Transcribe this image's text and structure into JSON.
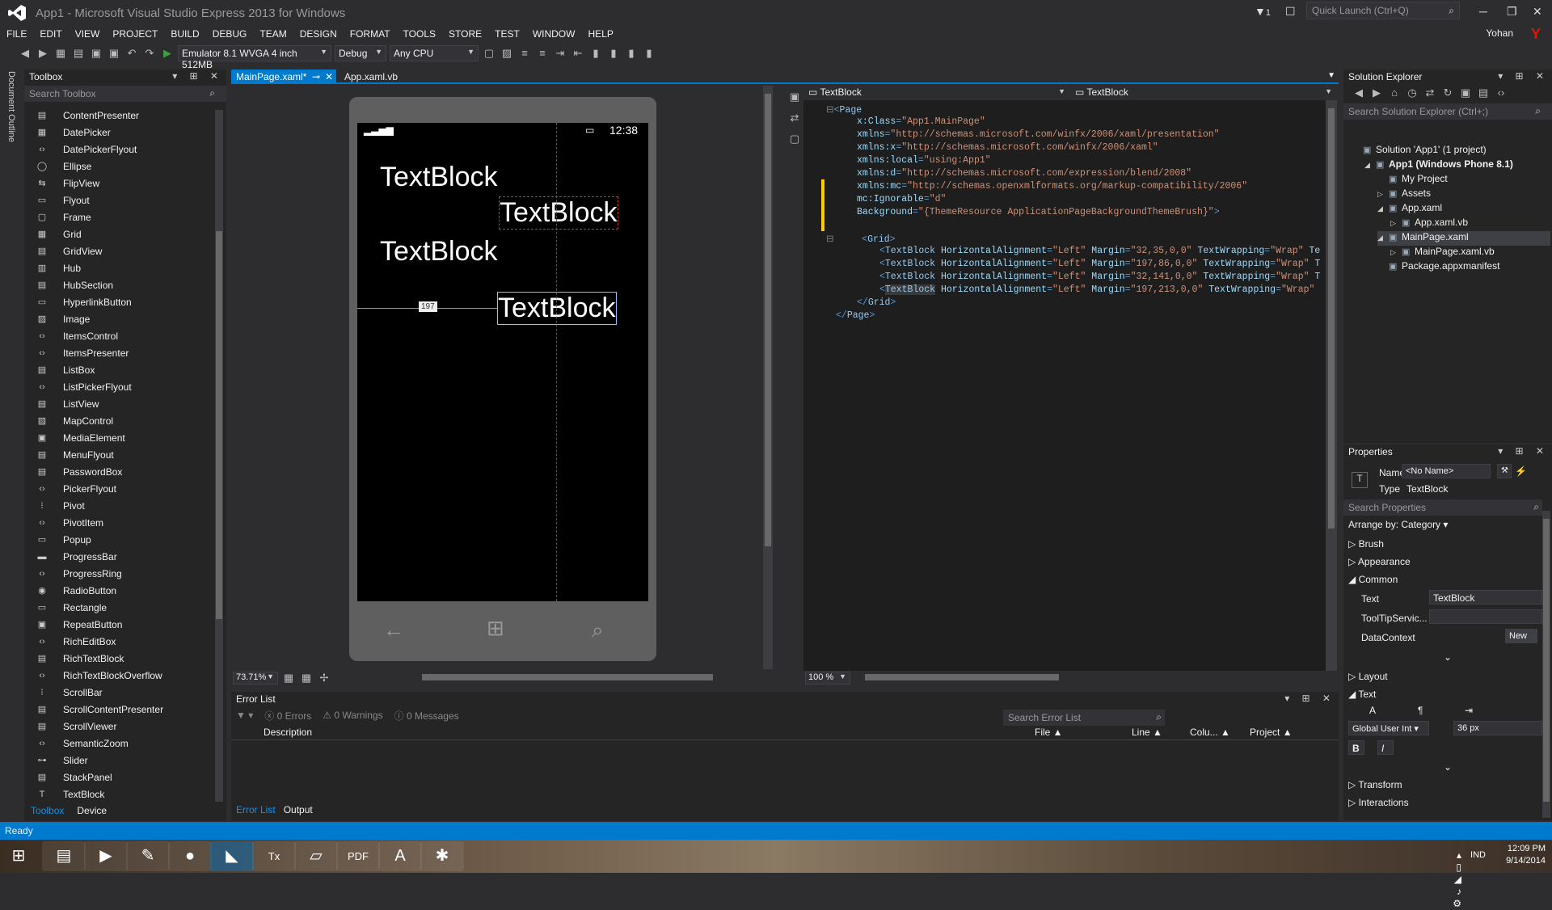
{
  "window": {
    "title": "App1 - Microsoft Visual Studio Express 2013 for Windows",
    "notification_count": "1",
    "quick_launch_placeholder": "Quick Launch (Ctrl+Q)",
    "user": "Yohan",
    "user_initial": "Y"
  },
  "menu": [
    "FILE",
    "EDIT",
    "VIEW",
    "PROJECT",
    "BUILD",
    "DEBUG",
    "TEAM",
    "DESIGN",
    "FORMAT",
    "TOOLS",
    "STORE",
    "TEST",
    "WINDOW",
    "HELP"
  ],
  "toolbar": {
    "target": "Emulator 8.1 WVGA 4 inch 512MB",
    "config": "Debug",
    "platform": "Any CPU"
  },
  "left_strip": "Document Outline",
  "toolbox": {
    "title": "Toolbox",
    "search_placeholder": "Search Toolbox",
    "items": [
      {
        "icon": "▤",
        "label": "ContentPresenter"
      },
      {
        "icon": "▦",
        "label": "DatePicker"
      },
      {
        "icon": "‹›",
        "label": "DatePickerFlyout"
      },
      {
        "icon": "◯",
        "label": "Ellipse"
      },
      {
        "icon": "⇆",
        "label": "FlipView"
      },
      {
        "icon": "▭",
        "label": "Flyout"
      },
      {
        "icon": "▢",
        "label": "Frame"
      },
      {
        "icon": "▦",
        "label": "Grid"
      },
      {
        "icon": "▤",
        "label": "GridView"
      },
      {
        "icon": "▥",
        "label": "Hub"
      },
      {
        "icon": "▤",
        "label": "HubSection"
      },
      {
        "icon": "▭",
        "label": "HyperlinkButton"
      },
      {
        "icon": "▨",
        "label": "Image"
      },
      {
        "icon": "‹›",
        "label": "ItemsControl"
      },
      {
        "icon": "‹›",
        "label": "ItemsPresenter"
      },
      {
        "icon": "▤",
        "label": "ListBox"
      },
      {
        "icon": "‹›",
        "label": "ListPickerFlyout"
      },
      {
        "icon": "▤",
        "label": "ListView"
      },
      {
        "icon": "▨",
        "label": "MapControl"
      },
      {
        "icon": "▣",
        "label": "MediaElement"
      },
      {
        "icon": "▤",
        "label": "MenuFlyout"
      },
      {
        "icon": "▤",
        "label": "PasswordBox"
      },
      {
        "icon": "‹›",
        "label": "PickerFlyout"
      },
      {
        "icon": "⁝",
        "label": "Pivot"
      },
      {
        "icon": "‹›",
        "label": "PivotItem"
      },
      {
        "icon": "▭",
        "label": "Popup"
      },
      {
        "icon": "▬",
        "label": "ProgressBar"
      },
      {
        "icon": "‹›",
        "label": "ProgressRing"
      },
      {
        "icon": "◉",
        "label": "RadioButton"
      },
      {
        "icon": "▭",
        "label": "Rectangle"
      },
      {
        "icon": "▣",
        "label": "RepeatButton"
      },
      {
        "icon": "‹›",
        "label": "RichEditBox"
      },
      {
        "icon": "▤",
        "label": "RichTextBlock"
      },
      {
        "icon": "‹›",
        "label": "RichTextBlockOverflow"
      },
      {
        "icon": "⁝",
        "label": "ScrollBar"
      },
      {
        "icon": "▤",
        "label": "ScrollContentPresenter"
      },
      {
        "icon": "▤",
        "label": "ScrollViewer"
      },
      {
        "icon": "‹›",
        "label": "SemanticZoom"
      },
      {
        "icon": "⊶",
        "label": "Slider"
      },
      {
        "icon": "▤",
        "label": "StackPanel"
      },
      {
        "icon": "T",
        "label": "TextBlock"
      }
    ],
    "bottom_tabs": [
      "Toolbox",
      "Device"
    ]
  },
  "tabs": [
    {
      "label": "MainPage.xaml*"
    },
    {
      "label": "App.xaml.vb"
    }
  ],
  "designer": {
    "clock": "12:38",
    "textblocks": [
      "TextBlock",
      "TextBlock",
      "TextBlock",
      "TextBlock"
    ],
    "margin_badge": "197",
    "zoom": "73.71%"
  },
  "xaml": {
    "left_combo": "TextBlock",
    "right_combo": "TextBlock",
    "zoom": "100 %"
  },
  "solution_explorer": {
    "title": "Solution Explorer",
    "search_placeholder": "Search Solution Explorer (Ctrl+;)",
    "items": [
      {
        "label": "Solution 'App1' (1 project)",
        "indent": 0,
        "tri": "",
        "bold": false
      },
      {
        "label": "App1 (Windows Phone 8.1)",
        "indent": 1,
        "tri": "◢",
        "bold": true
      },
      {
        "label": "My Project",
        "indent": 2,
        "tri": "",
        "bold": false
      },
      {
        "label": "Assets",
        "indent": 2,
        "tri": "▷",
        "bold": false
      },
      {
        "label": "App.xaml",
        "indent": 2,
        "tri": "◢",
        "bold": false
      },
      {
        "label": "App.xaml.vb",
        "indent": 3,
        "tri": "▷",
        "bold": false
      },
      {
        "label": "MainPage.xaml",
        "indent": 2,
        "tri": "◢",
        "bold": false
      },
      {
        "label": "MainPage.xaml.vb",
        "indent": 3,
        "tri": "▷",
        "bold": false
      },
      {
        "label": "Package.appxmanifest",
        "indent": 2,
        "tri": "",
        "bold": false
      }
    ]
  },
  "properties": {
    "title": "Properties",
    "name_label": "Name",
    "name_value": "<No Name>",
    "type_label": "Type",
    "type_value": "TextBlock",
    "search_placeholder": "Search Properties",
    "arrange": "Arrange by: Category",
    "cat_brush": "Brush",
    "cat_appearance": "Appearance",
    "cat_common": "Common",
    "text_label": "Text",
    "text_value": "TextBlock",
    "tooltip_label": "ToolTipServic...",
    "datacontext_label": "DataContext",
    "new_button": "New",
    "cat_layout": "Layout",
    "cat_text": "Text",
    "font_family": "Global User Int",
    "font_size": "36 px",
    "bold": "B",
    "italic": "I",
    "cat_transform": "Transform",
    "cat_interactions": "Interactions"
  },
  "error_list": {
    "title": "Error List",
    "errors": "0 Errors",
    "warnings": "0 Warnings",
    "messages": "0 Messages",
    "search_placeholder": "Search Error List",
    "columns": [
      "Description",
      "File",
      "Line",
      "Colu...",
      "Project"
    ],
    "bottom_tabs": [
      "Error List",
      "Output"
    ]
  },
  "status": "Ready",
  "tray": {
    "lang": "IND",
    "time": "12:09 PM",
    "date": "9/14/2014"
  },
  "taskbar_apps": [
    "explorer-icon",
    "media-player-icon",
    "notepadpp-icon",
    "firefox-icon",
    "visual-studio-icon",
    "latex-icon",
    "whiteboard-icon",
    "pdf-icon",
    "acrobat-icon",
    "paint-icon"
  ]
}
